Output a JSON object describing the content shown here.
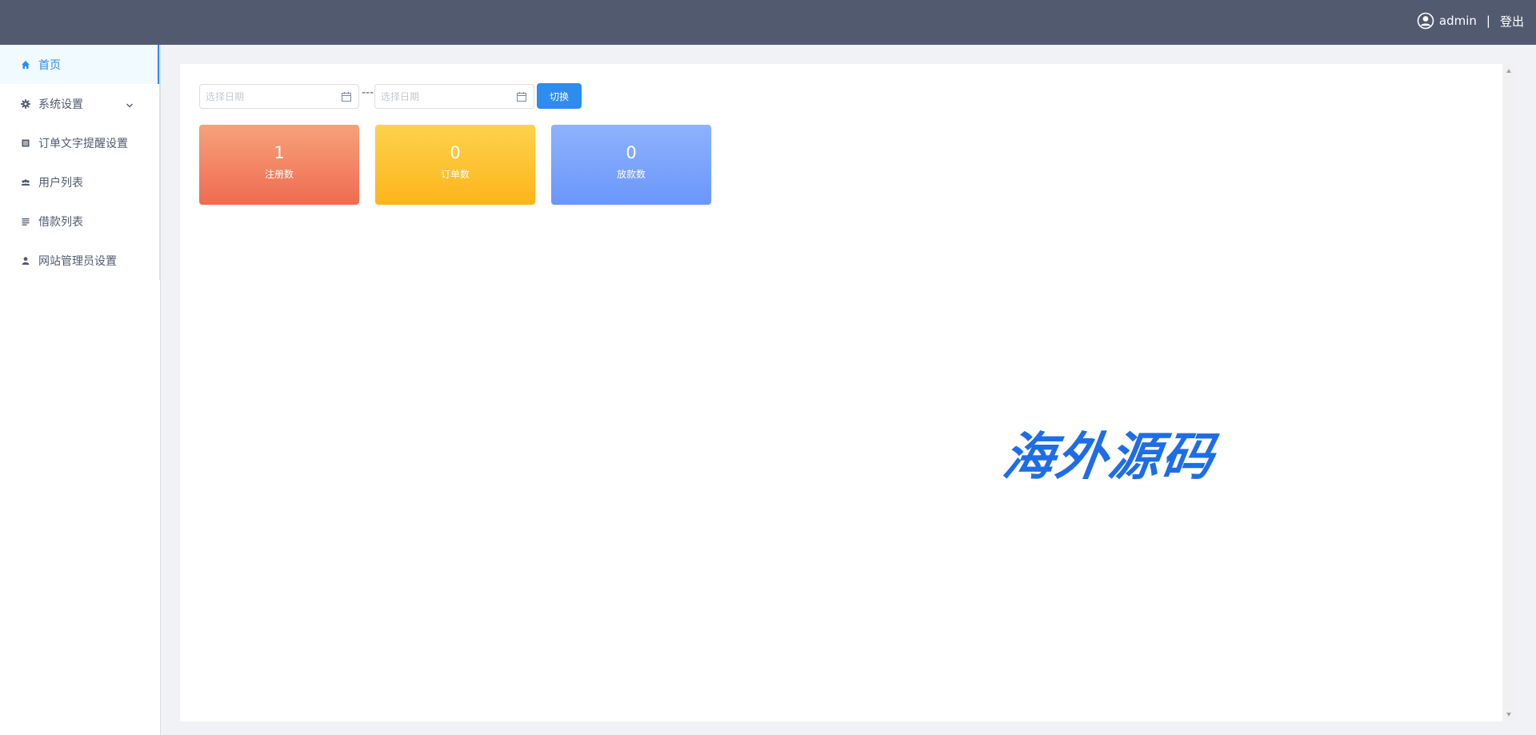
{
  "header": {
    "username": "admin",
    "separator": "|",
    "logout_label": "登出",
    "avatar_icon": "user-circle-icon"
  },
  "sidebar": {
    "items": [
      {
        "label": "首页",
        "icon": "home-icon",
        "active": true
      },
      {
        "label": "系统设置",
        "icon": "gear-icon",
        "has_submenu": true
      },
      {
        "label": "订单文字提醒设置",
        "icon": "document-icon"
      },
      {
        "label": "用户列表",
        "icon": "users-icon"
      },
      {
        "label": "借款列表",
        "icon": "list-icon"
      },
      {
        "label": "网站管理员设置",
        "icon": "user-icon"
      }
    ]
  },
  "filters": {
    "start_placeholder": "选择日期",
    "end_placeholder": "选择日期",
    "range_separator": "---",
    "switch_label": "切换"
  },
  "stats": [
    {
      "value": "1",
      "label": "注册数"
    },
    {
      "value": "0",
      "label": "订单数"
    },
    {
      "value": "0",
      "label": "放款数"
    }
  ],
  "watermark": "海外源码",
  "colors": {
    "topbar": "#515a6e",
    "accent": "#2d8cf0",
    "card_register": "#ef6b50",
    "card_order": "#fdb51b",
    "card_loan": "#6b96fb",
    "watermark": "#1e6de6"
  }
}
